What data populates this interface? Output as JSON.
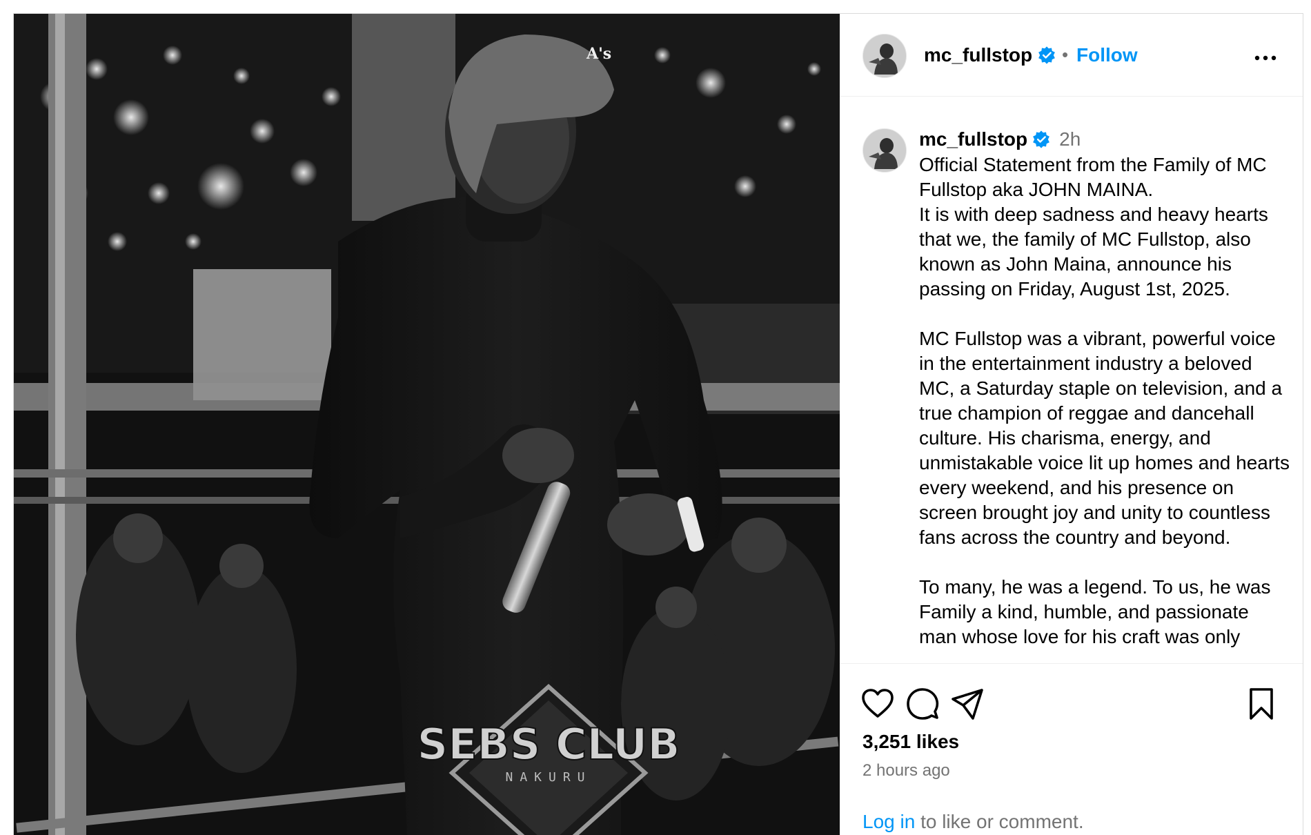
{
  "post": {
    "username": "mc_fullstop",
    "follow_label": "Follow",
    "header_separator": "•",
    "time_short": "2h",
    "caption": [
      "Official Statement from the Family of MC Fullstop aka JOHN MAINA.",
      "It is with deep sadness and heavy hearts that we, the family of MC Fullstop, also known as John Maina, announce his passing on Friday, August 1st, 2025.",
      "",
      "MC Fullstop was a vibrant, powerful voice in the entertainment industry a beloved MC, a Saturday staple on television, and a true champion of reggae and dancehall culture. His charisma, energy, and unmistakable voice lit up homes and hearts every weekend, and his presence on screen brought joy and unity to countless fans across the country and beyond.",
      "",
      "To many, he was a legend. To us, he was Family a kind, humble, and passionate man whose love for his craft was only"
    ],
    "likes": "3,251 likes",
    "time_long": "2 hours ago",
    "login_link": "Log in",
    "login_rest": " to like or comment.",
    "photo_watermark": "SEBS CLUB",
    "photo_watermark_sub": "NAKURU"
  },
  "icons": {
    "verified": "verified-badge-icon",
    "more": "more-options-icon",
    "like": "heart-icon",
    "comment": "comment-bubble-icon",
    "share": "paper-plane-icon",
    "save": "bookmark-icon"
  },
  "colors": {
    "link_blue": "#0095f6",
    "verified_blue": "#0095f6",
    "muted_text": "#737373",
    "border": "#dbdbdb"
  }
}
